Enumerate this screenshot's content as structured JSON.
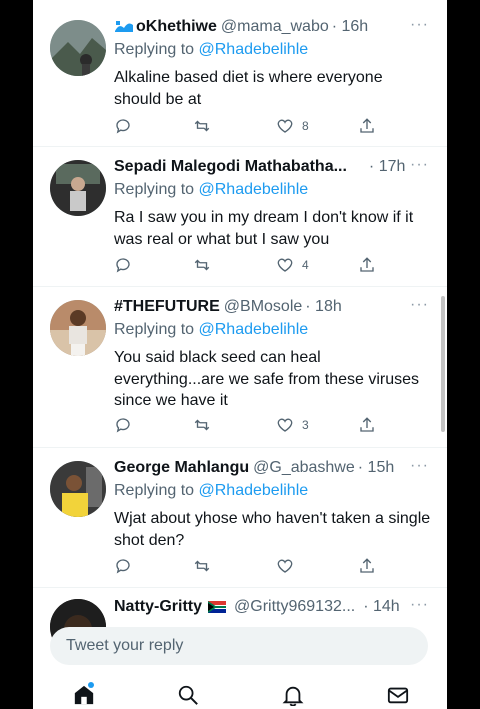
{
  "colors": {
    "accent": "#1d9bf0",
    "muted": "#536471",
    "text": "#0f1419"
  },
  "tweets": [
    {
      "name": "oKhethiwe",
      "handle": "@mama_wabo",
      "time": "· 16h",
      "reply_prefix": "Replying to",
      "reply_to": "@Rhadebelihle",
      "text": "Alkaline based diet is where everyone should be at",
      "likes": "8"
    },
    {
      "name": "Sepadi Malegodi Mathabatha...",
      "handle": "",
      "time": "· 17h",
      "reply_prefix": "Replying to",
      "reply_to": "@Rhadebelihle",
      "text": "Ra I saw you in my dream I don't know if it was real or what but I saw you",
      "likes": "4"
    },
    {
      "name": "#THEFUTURE",
      "handle": "@BMosole",
      "time": "· 18h",
      "reply_prefix": "Replying to",
      "reply_to": "@Rhadebelihle",
      "text": "You said black seed can heal everything...are we safe from these viruses since we have it",
      "likes": "3"
    },
    {
      "name": "George Mahlangu",
      "handle": "@G_abashwe",
      "time": "· 15h",
      "reply_prefix": "Replying to",
      "reply_to": "@Rhadebelihle",
      "text": "Wjat about yhose who haven't taken a single shot den?",
      "likes": ""
    },
    {
      "name": "Natty-Gritty",
      "handle": "@Gritty969132...",
      "time": "· 14h"
    }
  ],
  "more_glyph": "···",
  "reply_box": {
    "placeholder": "Tweet your reply"
  },
  "nav": {
    "icons": [
      "home-icon",
      "search-icon",
      "notifications-icon",
      "messages-icon"
    ]
  }
}
